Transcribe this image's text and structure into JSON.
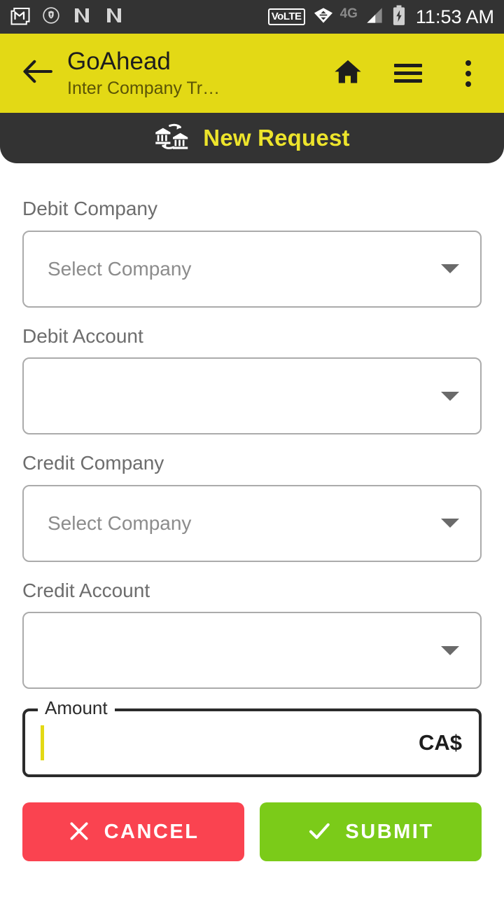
{
  "status_bar": {
    "icons": [
      "gmail-icon",
      "shield-key-icon",
      "nova-icon",
      "nova-icon-2"
    ],
    "volte_label": "VoLTE",
    "network_label": "4G",
    "time": "11:53 AM",
    "background_color": "#333333"
  },
  "app_bar": {
    "back_icon": "back-arrow-icon",
    "title": "GoAhead",
    "subtitle": "Inter Company Tr…",
    "home_icon": "home-icon",
    "menu_icon": "hamburger-menu-icon",
    "overflow_icon": "more-vertical-icon",
    "background_color": "#E3D915",
    "title_color": "#1D1D1D",
    "subtitle_color": "#5B5406"
  },
  "banner": {
    "icon": "bank-transfer-icon",
    "title": "New Request",
    "background_color": "#333333",
    "title_color": "#EDE42B"
  },
  "form": {
    "fields": [
      {
        "label": "Debit Company",
        "value": "Select Company",
        "caret_icon": "chevron-down-icon",
        "name": "debit-company"
      },
      {
        "label": "Debit Account",
        "value": "",
        "caret_icon": "chevron-down-icon",
        "name": "debit-account"
      },
      {
        "label": "Credit Company",
        "value": "Select Company",
        "caret_icon": "chevron-down-icon",
        "name": "credit-company"
      },
      {
        "label": "Credit Account",
        "value": "",
        "caret_icon": "chevron-down-icon",
        "name": "credit-account"
      }
    ],
    "amount": {
      "legend": "Amount",
      "value": "",
      "currency_suffix": "CA$",
      "cursor_color": "#E3D915",
      "border_color": "#2B2B2B"
    }
  },
  "actions": {
    "cancel": {
      "label": "CANCEL",
      "icon": "close-x-icon",
      "color": "#FA4350"
    },
    "submit": {
      "label": "SUBMIT",
      "icon": "check-icon",
      "color": "#7BCB19"
    }
  }
}
